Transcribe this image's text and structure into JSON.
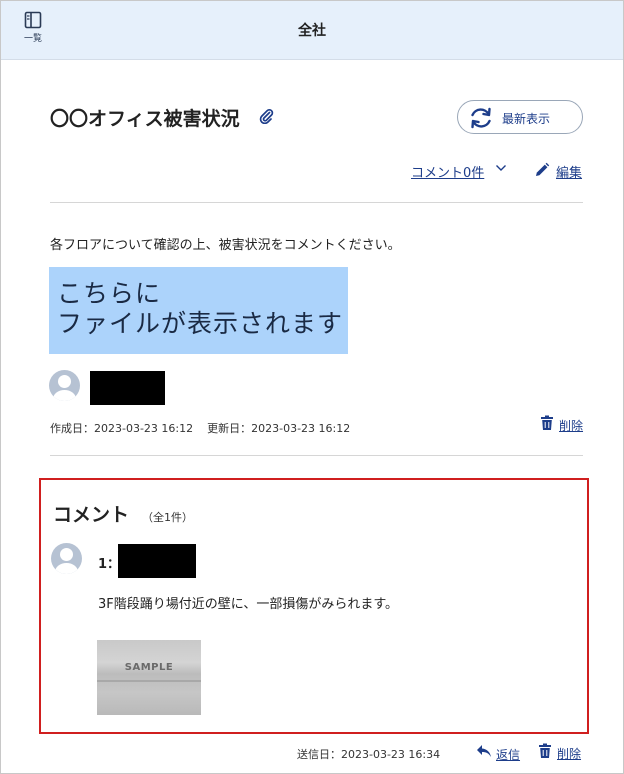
{
  "header": {
    "list_label": "一覧",
    "list_icon": "sidebar-layout-icon",
    "title": "全社"
  },
  "post": {
    "title": "〇〇オフィス被害状況",
    "attachment_icon": "paperclip-icon",
    "refresh_label": "最新表示",
    "refresh_icon": "refresh-icon",
    "comments_toggle_label": "コメント0件",
    "edit_label": "編集",
    "edit_icon": "pencil-icon",
    "description": "各フロアについて確認の上、被害状況をコメントください。",
    "file_placeholder_line1": "こちらに",
    "file_placeholder_line2": "ファイルが表示されます",
    "created_label": "作成日：2023-03-23 16:12",
    "updated_label": "更新日：2023-03-23 16:12",
    "delete_label": "削除",
    "delete_icon": "trash-icon"
  },
  "comments": {
    "heading": "コメント",
    "count_label": "（全1件）",
    "items": [
      {
        "number_label": "1：",
        "text": "3F階段踊り場付近の壁に、一部損傷がみられます。",
        "image_watermark": "SAMPLE",
        "sent_label": "送信日：2023-03-23 16:34",
        "reply_label": "返信",
        "delete_label": "削除"
      }
    ]
  },
  "colors": {
    "header_bg": "#e6f0fb",
    "link": "#1d3d8a",
    "highlight_border": "#d01f1f",
    "file_box_bg": "#acd3fb",
    "avatar": "#b6c2d3"
  }
}
